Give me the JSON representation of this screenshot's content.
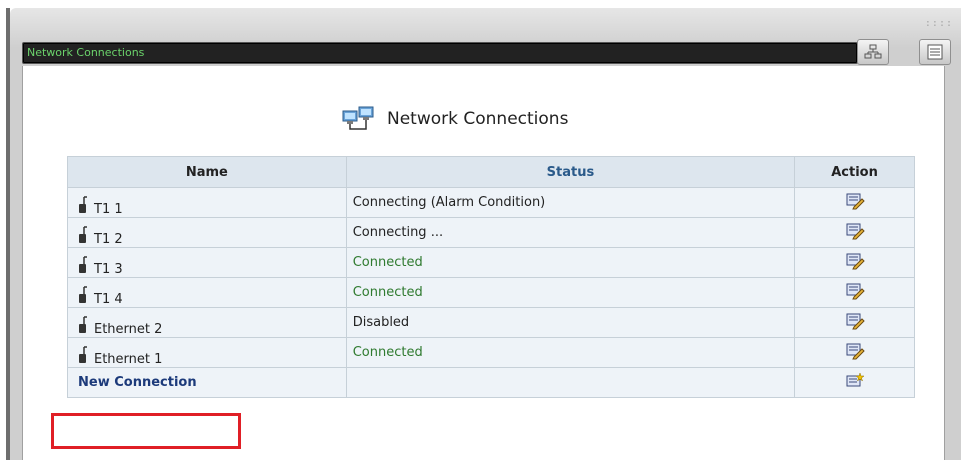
{
  "window": {
    "title": "Network Connections",
    "grip": "::::"
  },
  "page": {
    "heading": "Network Connections"
  },
  "table": {
    "columns": [
      "Name",
      "Status",
      "Action"
    ],
    "rows": [
      {
        "name": "T1 1",
        "status": "Connecting (Alarm Condition)",
        "status_color": "#222222"
      },
      {
        "name": "T1 2",
        "status": "Connecting ...",
        "status_color": "#222222"
      },
      {
        "name": "T1 3",
        "status": "Connected",
        "status_color": "#2f7a2f"
      },
      {
        "name": "T1 4",
        "status": "Connected",
        "status_color": "#2f7a2f"
      },
      {
        "name": "Ethernet 2",
        "status": "Disabled",
        "status_color": "#222222"
      },
      {
        "name": "Ethernet 1",
        "status": "Connected",
        "status_color": "#2f7a2f"
      }
    ],
    "new_connection": "New Connection"
  },
  "icons": {
    "heading": "network-computers-icon",
    "row": "plug-icon",
    "edit": "edit-icon",
    "new": "new-item-icon",
    "toolbar_1": "network-tree-icon",
    "toolbar_2": "list-icon"
  },
  "colors": {
    "title_text": "#6bd36b",
    "highlight": "#e01f26",
    "header_bg": "#dde6ee",
    "row_bg": "#eef3f8"
  }
}
